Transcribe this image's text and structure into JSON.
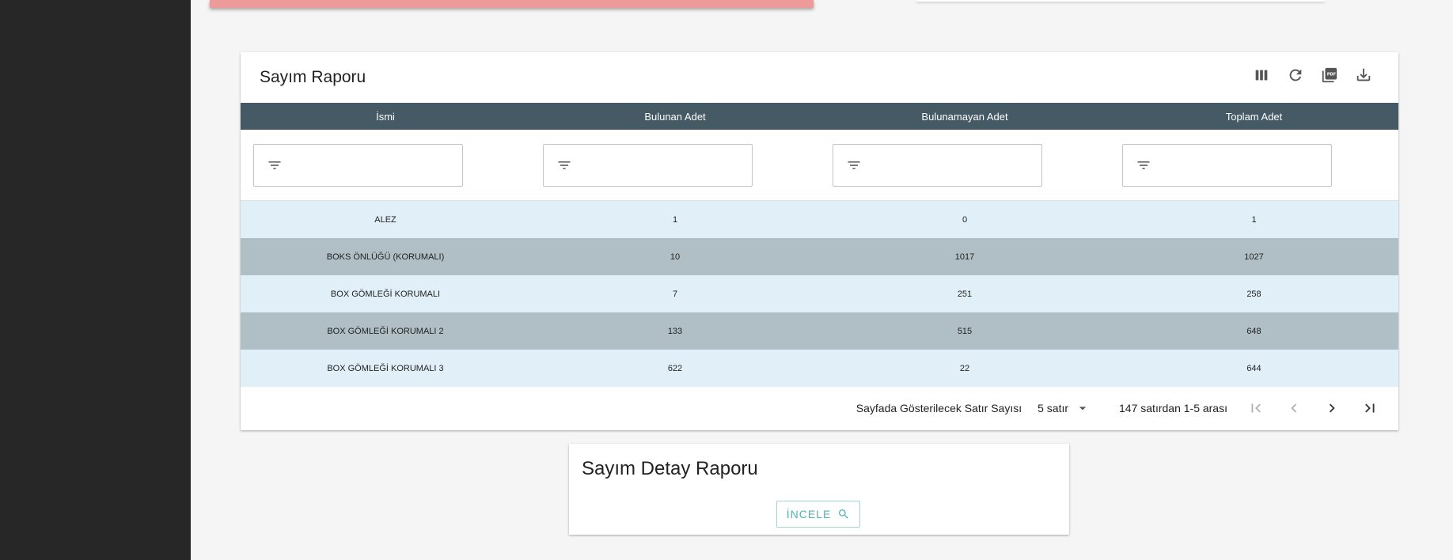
{
  "report": {
    "title": "Sayım Raporu",
    "toolbar": {
      "columns_icon": "view-column-icon",
      "refresh_icon": "refresh-icon",
      "pdf_icon": "pdf-icon",
      "download_icon": "download-icon"
    },
    "columns": [
      "İsmi",
      "Bulunan Adet",
      "Bulunamayan Adet",
      "Toplam Adet"
    ],
    "rows": [
      [
        "ALEZ",
        "1",
        "0",
        "1"
      ],
      [
        "BOKS ÖNLÜĞÜ (KORUMALI)",
        "10",
        "1017",
        "1027"
      ],
      [
        "BOX GÖMLEĞİ KORUMALI",
        "7",
        "251",
        "258"
      ],
      [
        "BOX GÖMLEĞİ KORUMALI 2",
        "133",
        "515",
        "648"
      ],
      [
        "BOX GÖMLEĞİ KORUMALI 3",
        "622",
        "22",
        "644"
      ]
    ],
    "pagination": {
      "rows_per_page_label": "Sayfada Gösterilecek Satır Sayısı",
      "rows_per_page_value": "5 satır",
      "range_label": "147 satırdan 1-5 arası"
    }
  },
  "detail": {
    "title": "Sayım Detay Raporu",
    "inspect_label": "İNCELE"
  },
  "colors": {
    "header_bg": "#455a64",
    "row_light": "#e1f0f8",
    "row_dark": "#b0bec5",
    "accent": "#4fb3b8",
    "sidebar": "#272727",
    "top_card": "#ef9a9a"
  }
}
